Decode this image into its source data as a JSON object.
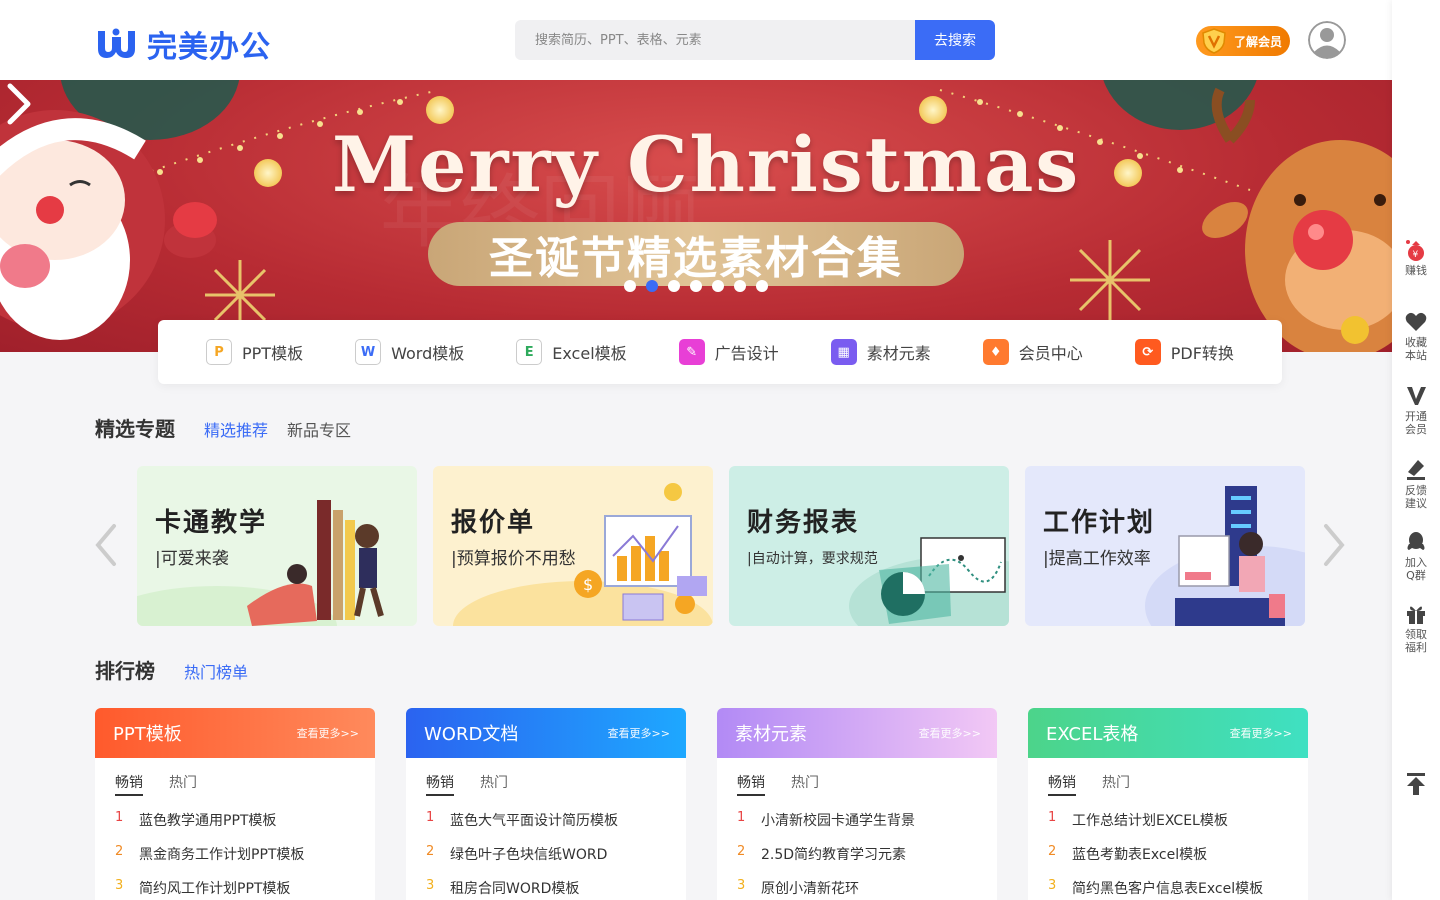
{
  "header": {
    "logo_text": "完美办公",
    "search_placeholder": "搜索简历、PPT、表格、元素",
    "search_button": "去搜索",
    "vip_button": "了解会员"
  },
  "banner": {
    "title": "Merry  Christmas",
    "subtitle": "圣诞节精选素材合集",
    "slide_count": 7,
    "active_slide": 2
  },
  "quick_nav": [
    {
      "label": "PPT模板",
      "icon": "ppt-file-icon",
      "color": "#f5a623"
    },
    {
      "label": "Word模板",
      "icon": "word-file-icon",
      "color": "#3b6cf6"
    },
    {
      "label": "Excel模板",
      "icon": "excel-file-icon",
      "color": "#2eaa5c"
    },
    {
      "label": "广告设计",
      "icon": "pen-icon",
      "color": "#e83fd6"
    },
    {
      "label": "素材元素",
      "icon": "grid-icon",
      "color": "#7a5cf0"
    },
    {
      "label": "会员中心",
      "icon": "diamond-icon",
      "color": "#ff7a2f"
    },
    {
      "label": "PDF转换",
      "icon": "convert-icon",
      "color": "#ff5a1f"
    }
  ],
  "topics_section": {
    "title": "精选专题",
    "tabs": [
      "精选推荐",
      "新品专区"
    ],
    "active_tab": 0,
    "cards": [
      {
        "title": "卡通教学",
        "subtitle": "|可爱来袭",
        "bg": "#e9f7e6"
      },
      {
        "title": "报价单",
        "subtitle": "|预算报价不用愁",
        "bg": "#fdf1cf"
      },
      {
        "title": "财务报表",
        "subtitle": "|自动计算，要求规范",
        "bg": "#cdeee6"
      },
      {
        "title": "工作计划",
        "subtitle": "|提高工作效率",
        "bg": "#e4e8fb"
      }
    ]
  },
  "ranking_section": {
    "title": "排行榜",
    "tab": "热门榜单",
    "more_label": "查看更多>>",
    "sub_tabs": [
      "畅销",
      "热门"
    ],
    "boards": [
      {
        "title": "PPT模板",
        "items": [
          "蓝色教学通用PPT模板",
          "黑金商务工作计划PPT模板",
          "简约风工作计划PPT模板"
        ]
      },
      {
        "title": "WORD文档",
        "items": [
          "蓝色大气平面设计简历模板",
          "绿色叶子色块信纸WORD",
          "租房合同WORD模板"
        ]
      },
      {
        "title": "素材元素",
        "items": [
          "小清新校园卡通学生背景",
          "2.5D简约教育学习元素",
          "原创小清新花环"
        ]
      },
      {
        "title": "EXCEL表格",
        "items": [
          "工作总结计划EXCEL模板",
          "蓝色考勤表Excel模板",
          "简约黑色客户信息表Excel模板"
        ]
      }
    ],
    "rank_colors": [
      "#e84545",
      "#f08a24",
      "#f2b01e"
    ]
  },
  "sidebar": [
    {
      "label": "赚钱",
      "icon": "money-bag-icon"
    },
    {
      "label": "收藏本站",
      "icon": "heart-icon"
    },
    {
      "label": "开通会员",
      "icon": "vip-v-icon"
    },
    {
      "label": "反馈建议",
      "icon": "feedback-icon"
    },
    {
      "label": "加入Q群",
      "icon": "qq-icon"
    },
    {
      "label": "领取福利",
      "icon": "gift-icon"
    }
  ],
  "colors": {
    "brand": "#2b63f0",
    "search_button": "#3b6cf6",
    "tab_active": "#3b6cf6"
  }
}
